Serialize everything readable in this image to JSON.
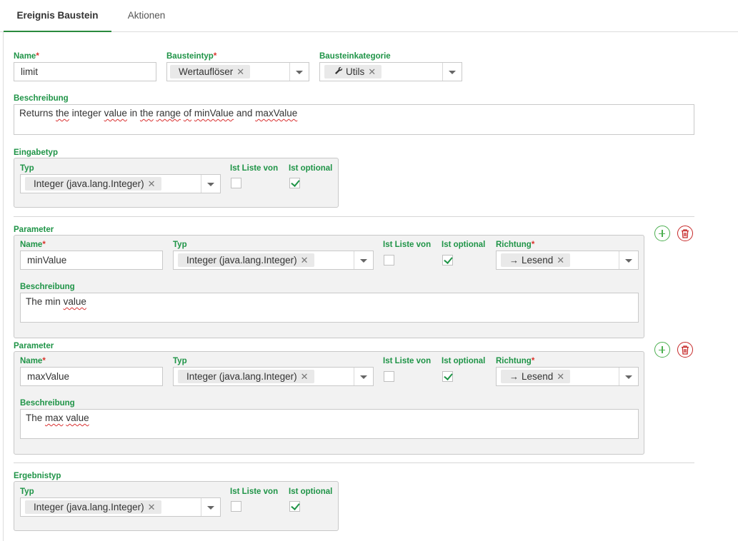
{
  "tabs": [
    {
      "label": "Ereignis Baustein",
      "active": true
    },
    {
      "label": "Aktionen",
      "active": false
    }
  ],
  "form": {
    "name_label": "Name",
    "name_value": "limit",
    "bausteintyp_label": "Bausteintyp",
    "bausteintyp_value": "Wertauflöser",
    "bausteinkategorie_label": "Bausteinkategorie",
    "bausteinkategorie_value": "Utils",
    "bausteinkategorie_icon": "wrench-icon",
    "beschreibung_label": "Beschreibung",
    "beschreibung_words": [
      "Returns",
      "the",
      "integer",
      "value",
      "in",
      "the",
      "range",
      "of",
      "minValue",
      "and",
      "maxValue"
    ],
    "required_marker": "*",
    "remove_glyph": "✕"
  },
  "eingabetyp": {
    "section_label": "Eingabetyp",
    "typ_label": "Typ",
    "typ_value": "Integer (java.lang.Integer)",
    "ist_liste_von_label": "Ist Liste von",
    "ist_liste_von_checked": false,
    "ist_optional_label": "Ist optional",
    "ist_optional_checked": true
  },
  "parameters": [
    {
      "section_label": "Parameter",
      "name_label": "Name",
      "name_value": "minValue",
      "typ_label": "Typ",
      "typ_value": "Integer (java.lang.Integer)",
      "ist_liste_von_label": "Ist Liste von",
      "ist_liste_von_checked": false,
      "ist_optional_label": "Ist optional",
      "ist_optional_checked": true,
      "richtung_label": "Richtung",
      "richtung_value": "Lesend",
      "richtung_icon": "arrow-right-icon",
      "beschreibung_label": "Beschreibung",
      "beschreibung_words": [
        "The",
        "min",
        "value"
      ]
    },
    {
      "section_label": "Parameter",
      "name_label": "Name",
      "name_value": "maxValue",
      "typ_label": "Typ",
      "typ_value": "Integer (java.lang.Integer)",
      "ist_liste_von_label": "Ist Liste von",
      "ist_liste_von_checked": false,
      "ist_optional_label": "Ist optional",
      "ist_optional_checked": true,
      "richtung_label": "Richtung",
      "richtung_value": "Lesend",
      "richtung_icon": "arrow-right-icon",
      "beschreibung_label": "Beschreibung",
      "beschreibung_words": [
        "The",
        "max",
        "value"
      ]
    }
  ],
  "ergebnistyp": {
    "section_label": "Ergebnistyp",
    "typ_label": "Typ",
    "typ_value": "Integer (java.lang.Integer)",
    "ist_liste_von_label": "Ist Liste von",
    "ist_liste_von_checked": false,
    "ist_optional_label": "Ist optional",
    "ist_optional_checked": true
  },
  "colors": {
    "label_green": "#1f9447",
    "required_red": "#d9352c",
    "add_button_green": "#4caf50",
    "delete_button_red": "#c62828",
    "tab_underline": "#2a8a3e"
  },
  "icons": {
    "add": "plus-circle-icon",
    "delete": "trash-circle-icon",
    "dropdown": "chevron-down-icon"
  }
}
